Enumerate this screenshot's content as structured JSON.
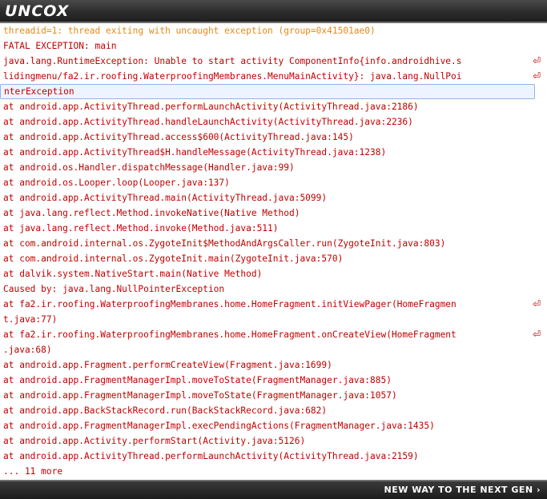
{
  "header": {
    "logo": "UNCOX"
  },
  "footer": {
    "slogan": "NEW WAY TO THE NEXT GEN ›"
  },
  "log_lines": [
    {
      "text": "threadid=1: thread exiting with uncaught exception (group=0x41501ae0)",
      "kind": "thread",
      "wrap": false
    },
    {
      "text": "FATAL EXCEPTION: main",
      "kind": "error",
      "wrap": false
    },
    {
      "text": "java.lang.RuntimeException: Unable to start activity ComponentInfo{info.androidhive.s",
      "kind": "error",
      "wrap": true
    },
    {
      "text": "lidingmenu/fa2.ir.roofing.WaterproofingMembranes.MenuMainActivity}: java.lang.NullPoi",
      "kind": "error",
      "wrap": true
    },
    {
      "text": "nterException",
      "kind": "error",
      "wrap": false,
      "selected": true
    },
    {
      "text": "at android.app.ActivityThread.performLaunchActivity(ActivityThread.java:2186)",
      "kind": "error",
      "wrap": false
    },
    {
      "text": "at android.app.ActivityThread.handleLaunchActivity(ActivityThread.java:2236)",
      "kind": "error",
      "wrap": false
    },
    {
      "text": "at android.app.ActivityThread.access$600(ActivityThread.java:145)",
      "kind": "error",
      "wrap": false
    },
    {
      "text": "at android.app.ActivityThread$H.handleMessage(ActivityThread.java:1238)",
      "kind": "error",
      "wrap": false
    },
    {
      "text": "at android.os.Handler.dispatchMessage(Handler.java:99)",
      "kind": "error",
      "wrap": false
    },
    {
      "text": "at android.os.Looper.loop(Looper.java:137)",
      "kind": "error",
      "wrap": false
    },
    {
      "text": "at android.app.ActivityThread.main(ActivityThread.java:5099)",
      "kind": "error",
      "wrap": false
    },
    {
      "text": "at java.lang.reflect.Method.invokeNative(Native Method)",
      "kind": "error",
      "wrap": false
    },
    {
      "text": "at java.lang.reflect.Method.invoke(Method.java:511)",
      "kind": "error",
      "wrap": false
    },
    {
      "text": "at com.android.internal.os.ZygoteInit$MethodAndArgsCaller.run(ZygoteInit.java:803)",
      "kind": "error",
      "wrap": false
    },
    {
      "text": "at com.android.internal.os.ZygoteInit.main(ZygoteInit.java:570)",
      "kind": "error",
      "wrap": false
    },
    {
      "text": "at dalvik.system.NativeStart.main(Native Method)",
      "kind": "error",
      "wrap": false
    },
    {
      "text": "Caused by: java.lang.NullPointerException",
      "kind": "error",
      "wrap": false
    },
    {
      "text": "at fa2.ir.roofing.WaterproofingMembranes.home.HomeFragment.initViewPager(HomeFragmen",
      "kind": "error",
      "wrap": true
    },
    {
      "text": "t.java:77)",
      "kind": "error",
      "wrap": false
    },
    {
      "text": "at fa2.ir.roofing.WaterproofingMembranes.home.HomeFragment.onCreateView(HomeFragment",
      "kind": "error",
      "wrap": true
    },
    {
      "text": ".java:68)",
      "kind": "error",
      "wrap": false
    },
    {
      "text": "at android.app.Fragment.performCreateView(Fragment.java:1699)",
      "kind": "error",
      "wrap": false
    },
    {
      "text": "at android.app.FragmentManagerImpl.moveToState(FragmentManager.java:885)",
      "kind": "error",
      "wrap": false
    },
    {
      "text": "at android.app.FragmentManagerImpl.moveToState(FragmentManager.java:1057)",
      "kind": "error",
      "wrap": false
    },
    {
      "text": "at android.app.BackStackRecord.run(BackStackRecord.java:682)",
      "kind": "error",
      "wrap": false
    },
    {
      "text": "at android.app.FragmentManagerImpl.execPendingActions(FragmentManager.java:1435)",
      "kind": "error",
      "wrap": false
    },
    {
      "text": "at android.app.Activity.performStart(Activity.java:5126)",
      "kind": "error",
      "wrap": false
    },
    {
      "text": "at android.app.ActivityThread.performLaunchActivity(ActivityThread.java:2159)",
      "kind": "error",
      "wrap": false
    },
    {
      "text": "... 11 more",
      "kind": "error",
      "wrap": false
    }
  ],
  "wrap_glyph": "⏎",
  "colors": {
    "thread_text": "#e08a1e",
    "error_text": "#c00000",
    "selection_border": "#8fb3e6",
    "bar_background": "#2c2c2c"
  }
}
